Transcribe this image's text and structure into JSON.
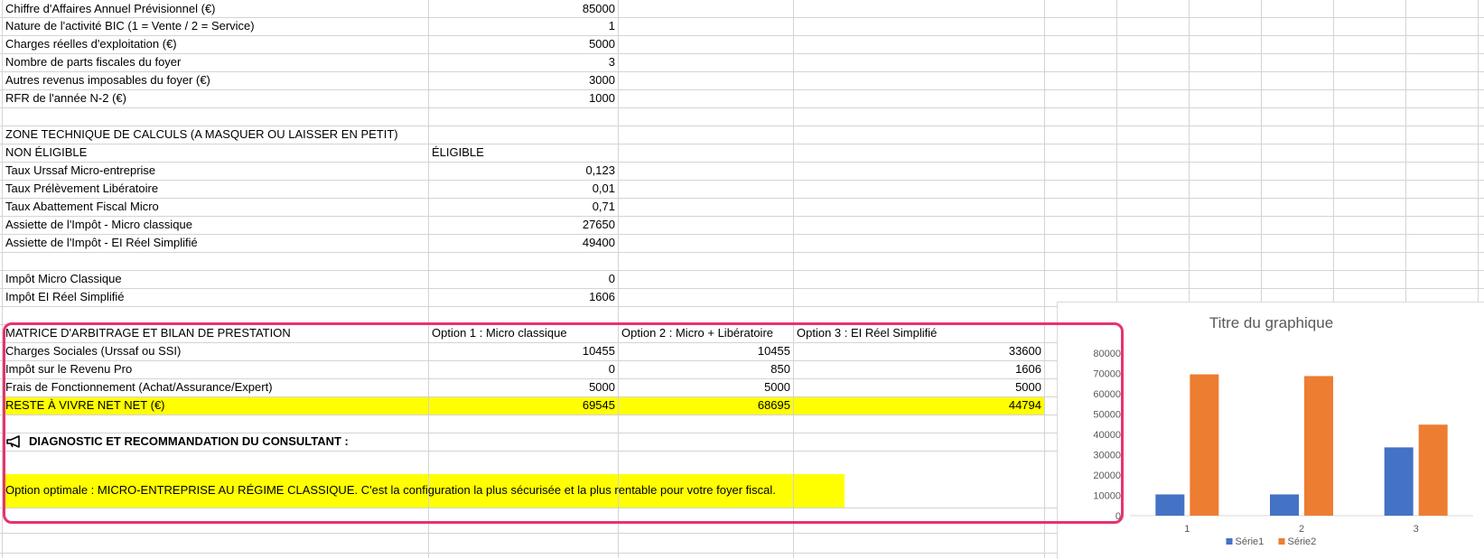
{
  "rows": [
    {
      "label": "Chiffre d'Affaires Annuel Prévisionnel (€)",
      "value": "85000"
    },
    {
      "label": "Nature de l'activité BIC (1 = Vente / 2 = Service)",
      "value": "1"
    },
    {
      "label": "Charges réelles d'exploitation (€)",
      "value": "5000"
    },
    {
      "label": "Nombre de parts fiscales du foyer",
      "value": "3"
    },
    {
      "label": "Autres revenus imposables du foyer (€)",
      "value": "3000"
    },
    {
      "label": "RFR de l'année N-2 (€)",
      "value": "1000"
    },
    {
      "label": "",
      "value": ""
    },
    {
      "label": "ZONE TECHNIQUE DE CALCULS (A MASQUER OU LAISSER EN PETIT)",
      "value": ""
    },
    {
      "label": "NON ÉLIGIBLE",
      "value_left": "ÉLIGIBLE"
    },
    {
      "label": "Taux Urssaf Micro-entreprise",
      "value": "0,123"
    },
    {
      "label": "Taux Prélèvement Libératoire",
      "value": "0,01"
    },
    {
      "label": "Taux Abattement Fiscal Micro",
      "value": "0,71"
    },
    {
      "label": "Assiette de l'Impôt - Micro classique",
      "value": "27650"
    },
    {
      "label": "Assiette de l'Impôt - EI Réel Simplifié",
      "value": "49400"
    },
    {
      "label": "",
      "value": ""
    },
    {
      "label": "Impôt Micro Classique",
      "value": "0"
    },
    {
      "label": "Impôt EI Réel Simplifié",
      "value": "1606"
    }
  ],
  "matrix": {
    "header": [
      "MATRICE D'ARBITRAGE ET BILAN DE PRESTATION",
      "Option 1 : Micro classique",
      "Option 2 : Micro + Libératoire",
      "Option 3 : EI Réel Simplifié"
    ],
    "rows": [
      [
        "Charges Sociales (Urssaf ou SSI)",
        "10455",
        "10455",
        "33600"
      ],
      [
        "Impôt sur le Revenu Pro",
        "0",
        "850",
        "1606"
      ],
      [
        "Frais de Fonctionnement (Achat/Assurance/Expert)",
        "5000",
        "5000",
        "5000"
      ],
      [
        "RESTE À VIVRE NET NET (€)",
        "69545",
        "68695",
        "44794"
      ]
    ],
    "diagnostic_title": "DIAGNOSTIC ET RECOMMANDATION DU CONSULTANT :",
    "recommendation": "Option optimale : MICRO-ENTREPRISE AU RÉGIME CLASSIQUE. C'est la configuration la plus sécurisée et la plus rentable pour votre foyer fiscal."
  },
  "highlight_color": "#ffff00",
  "callout_color": "#e8336b",
  "chart_data": {
    "type": "bar",
    "title": "Titre du graphique",
    "categories": [
      "1",
      "2",
      "3"
    ],
    "series": [
      {
        "name": "Série1",
        "values": [
          10455,
          10455,
          33600
        ],
        "color": "#4472c4"
      },
      {
        "name": "Série2",
        "values": [
          69545,
          68695,
          44794
        ],
        "color": "#ed7d31"
      }
    ],
    "ylim": [
      0,
      80000
    ],
    "yticks": [
      "0",
      "10000",
      "20000",
      "30000",
      "40000",
      "50000",
      "60000",
      "70000",
      "80000"
    ],
    "legend": "bottom",
    "grid": false
  }
}
